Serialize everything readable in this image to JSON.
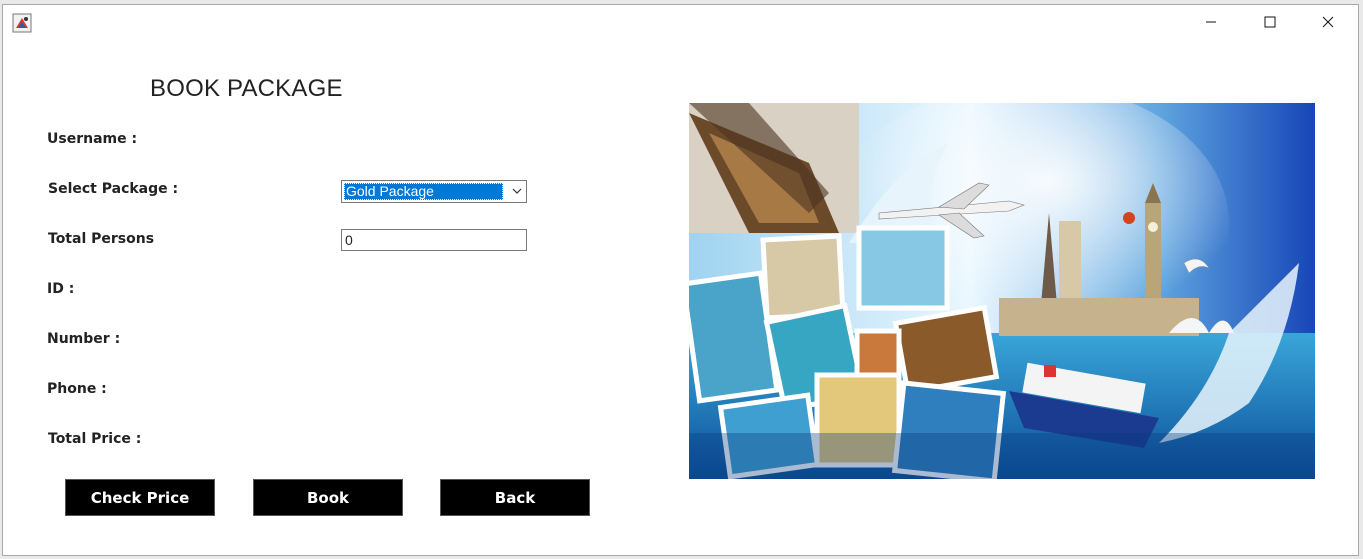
{
  "form": {
    "title": "BOOK PACKAGE",
    "username_label": "Username :",
    "package_label": "Select Package :",
    "package_selected": "Gold Package",
    "persons_label": "Total Persons",
    "persons_value": "0",
    "id_label": "ID :",
    "number_label": "Number :",
    "phone_label": "Phone :",
    "price_label": "Total Price :"
  },
  "buttons": {
    "check_price": "Check Price",
    "book": "Book",
    "back": "Back"
  },
  "icons": {
    "app": "java-app-icon",
    "minimize": "minimize-icon",
    "maximize": "maximize-icon",
    "close": "close-icon",
    "dropdown": "chevron-down-icon"
  },
  "colors": {
    "button_bg": "#000000",
    "button_text": "#ffffff",
    "selection": "#0078d7"
  }
}
